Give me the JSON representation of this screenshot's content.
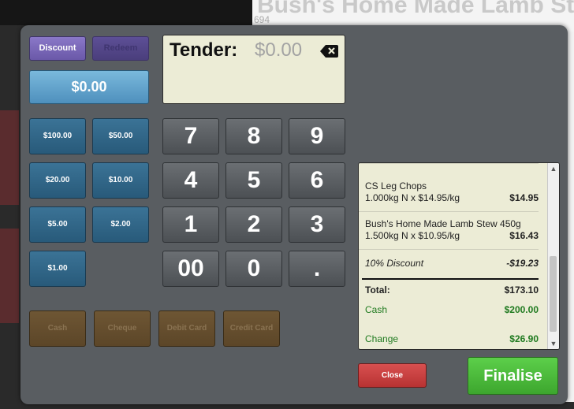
{
  "background": {
    "title_text": "Bush's Home Made Lamb Ste",
    "subtitle": "694"
  },
  "tender": {
    "label": "Tender:",
    "value": "$0.00",
    "backspace_icon": "backspace-icon"
  },
  "buttons": {
    "discount": "Discount",
    "redeem": "Redeem",
    "amount": "$0.00",
    "denominations": [
      "$100.00",
      "$50.00",
      "$20.00",
      "$10.00",
      "$5.00",
      "$2.00",
      "$1.00"
    ],
    "keypad": [
      "7",
      "8",
      "9",
      "4",
      "5",
      "6",
      "1",
      "2",
      "3",
      "00",
      "0",
      "."
    ],
    "tender_types": [
      "Cash",
      "Cheque",
      "Debit Card",
      "Credit Card"
    ],
    "close": "Close",
    "finalise": "Finalise"
  },
  "receipt": {
    "items": [
      {
        "name": "CS Leg Chops",
        "detail": "1.000kg N x $14.95/kg",
        "amount": "$14.95"
      },
      {
        "name": "Bush's Home Made Lamb Stew 450g",
        "detail": "1.500kg N x $10.95/kg",
        "amount": "$16.43"
      }
    ],
    "discount": {
      "label": "10% Discount",
      "amount": "-$19.23"
    },
    "total": {
      "label": "Total:",
      "amount": "$173.10"
    },
    "cash": {
      "label": "Cash",
      "amount": "$200.00"
    },
    "change": {
      "label": "Change",
      "amount": "$26.90"
    }
  },
  "colors": {
    "dialog": "#595d61",
    "receipt_bg": "#ececd6",
    "finalise_green": "#4cbb3c",
    "close_red": "#c84040",
    "amount_green": "#1f7a1f"
  }
}
